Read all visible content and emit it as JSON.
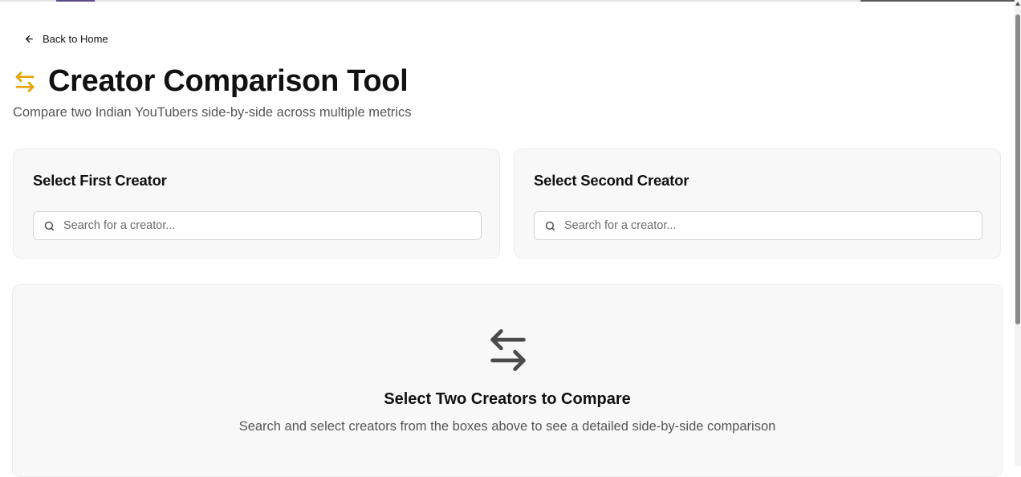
{
  "nav": {
    "back_label": "Back to Home"
  },
  "header": {
    "title": "Creator Comparison Tool",
    "subtitle": "Compare two Indian YouTubers side-by-side across multiple metrics"
  },
  "selectors": [
    {
      "title": "Select First Creator",
      "placeholder": "Search for a creator..."
    },
    {
      "title": "Select Second Creator",
      "placeholder": "Search for a creator..."
    }
  ],
  "empty_state": {
    "title": "Select Two Creators to Compare",
    "description": "Search and select creators from the boxes above to see a detailed side-by-side comparison"
  },
  "icons": {
    "back": "arrow-left-icon",
    "title": "swap-arrows-icon",
    "search": "search-icon",
    "empty": "swap-arrows-icon"
  },
  "colors": {
    "accent": "#e5a50a",
    "icon_gray": "#4b4b4b",
    "card_bg": "#f8f8f8",
    "text_muted": "#555555"
  }
}
